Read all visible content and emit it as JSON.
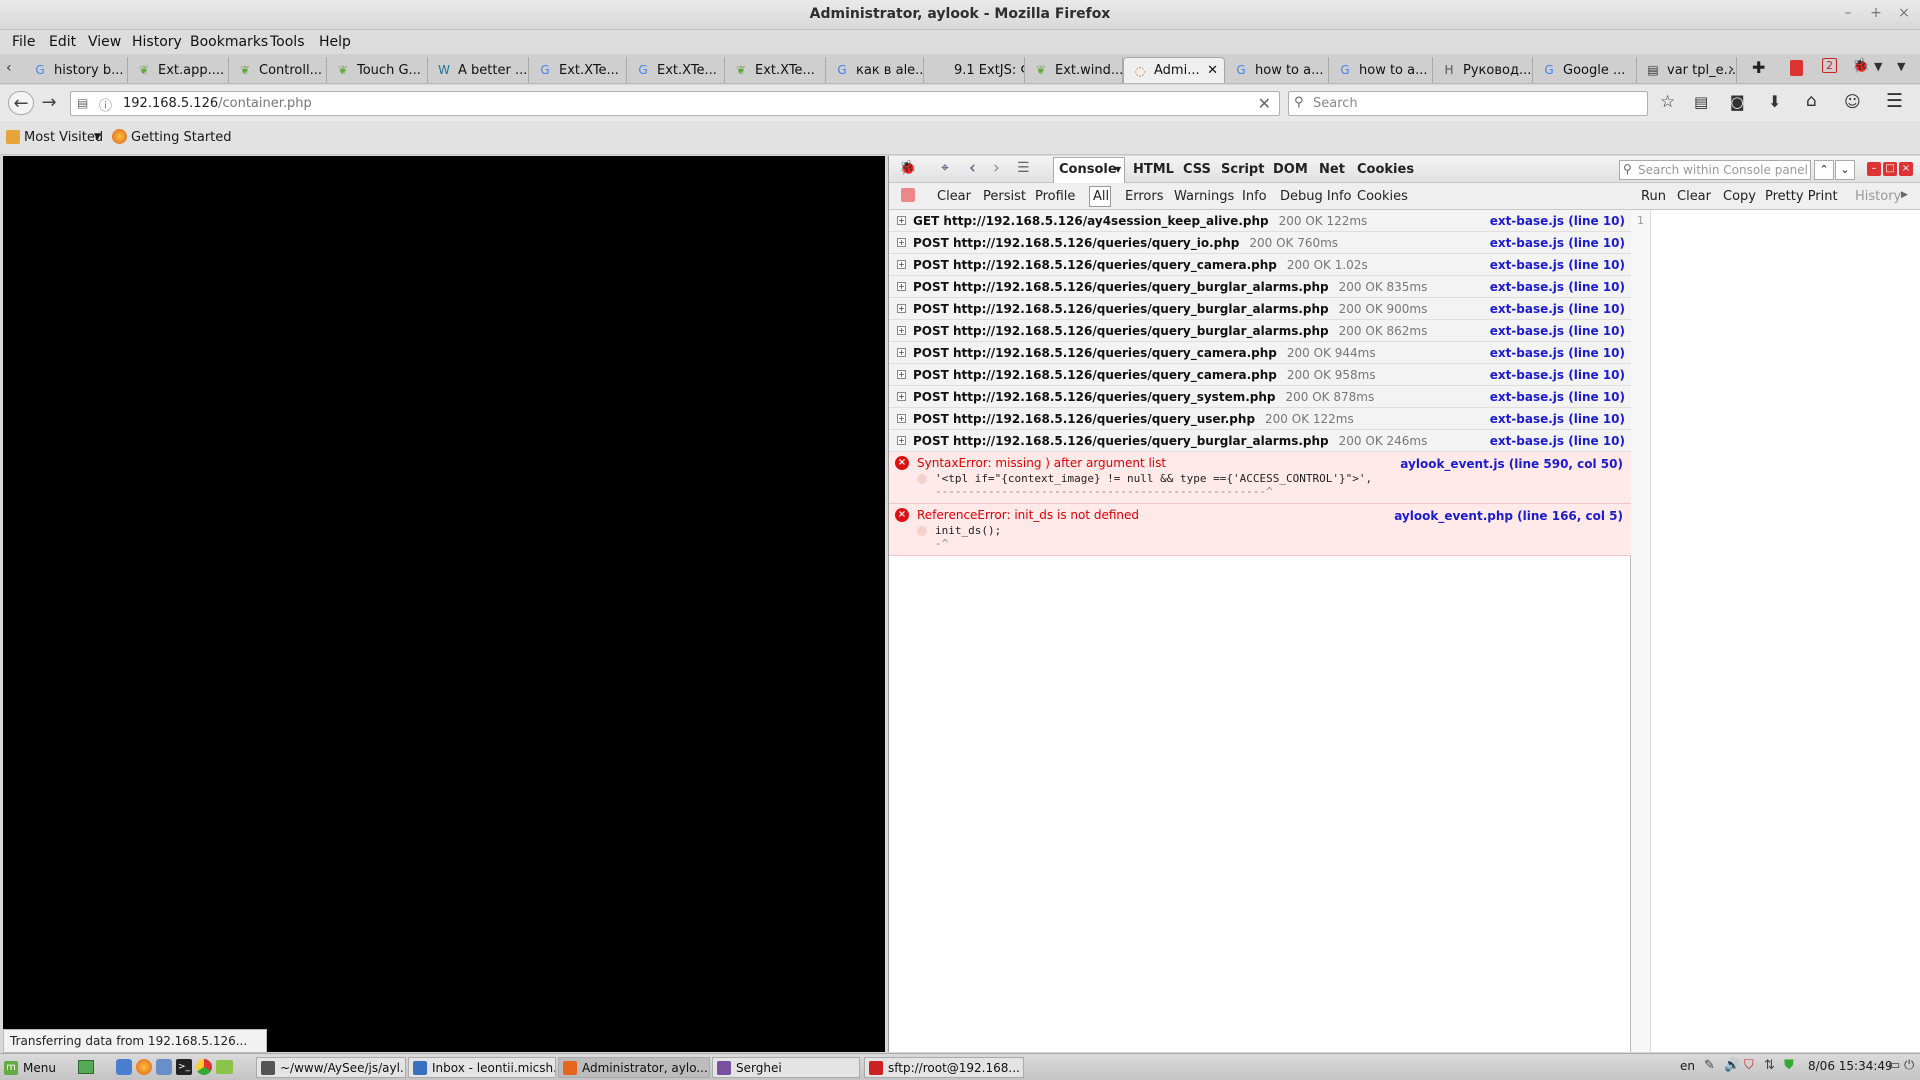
{
  "window": {
    "title": "Administrator, aylook - Mozilla Firefox"
  },
  "menu": [
    "File",
    "Edit",
    "View",
    "History",
    "Bookmarks",
    "Tools",
    "Help"
  ],
  "tabs": [
    {
      "label": "history b...",
      "icon": "google-icon"
    },
    {
      "label": "Ext.app....",
      "icon": "leaf-icon"
    },
    {
      "label": "Controll...",
      "icon": "leaf-icon"
    },
    {
      "label": "Touch G...",
      "icon": "leaf-icon"
    },
    {
      "label": "A better ...",
      "icon": "wordpress-icon"
    },
    {
      "label": "Ext.XTe...",
      "icon": "google-icon"
    },
    {
      "label": "Ext.XTe...",
      "icon": "google-icon"
    },
    {
      "label": "Ext.XTe...",
      "icon": "leaf-icon"
    },
    {
      "label": "как в ale...",
      "icon": "google-icon"
    },
    {
      "label": "9.1 ExtJS: Фо...",
      "icon": "none"
    },
    {
      "label": "Ext.wind...",
      "icon": "leaf-icon"
    },
    {
      "label": "Admi...",
      "icon": "loading-icon",
      "active": true
    },
    {
      "label": "how to a...",
      "icon": "google-icon"
    },
    {
      "label": "how to a...",
      "icon": "google-icon"
    },
    {
      "label": "Руковод...",
      "icon": "habr-icon"
    },
    {
      "label": "Google ...",
      "icon": "google-translate-icon"
    },
    {
      "label": "var tpl_e...",
      "icon": "script-icon"
    }
  ],
  "nav": {
    "url_host": "192.168.5.126",
    "url_path": "/container.php",
    "search_placeholder": "Search"
  },
  "bookmarks": {
    "most_visited": "Most Visited",
    "getting_started": "Getting Started"
  },
  "status": {
    "text": "Transferring data from 192.168.5.126..."
  },
  "firebug": {
    "panels": [
      "Console",
      "HTML",
      "CSS",
      "Script",
      "DOM",
      "Net",
      "Cookies"
    ],
    "search_placeholder": "Search within Console panel",
    "sub_left": [
      "Clear",
      "Persist",
      "Profile"
    ],
    "filters": [
      "All",
      "Errors",
      "Warnings",
      "Info",
      "Debug Info",
      "Cookies"
    ],
    "sub_right": [
      "Run",
      "Clear",
      "Copy",
      "Pretty Print",
      "History"
    ],
    "line_number": "1",
    "requests": [
      {
        "method": "GET",
        "url": "http://192.168.5.126/ay4session_keep_alive.php",
        "status": "200 OK 122ms",
        "source": "ext-base.js (line 10)"
      },
      {
        "method": "POST",
        "url": "http://192.168.5.126/queries/query_io.php",
        "status": "200 OK 760ms",
        "source": "ext-base.js (line 10)"
      },
      {
        "method": "POST",
        "url": "http://192.168.5.126/queries/query_camera.php",
        "status": "200 OK 1.02s",
        "source": "ext-base.js (line 10)"
      },
      {
        "method": "POST",
        "url": "http://192.168.5.126/queries/query_burglar_alarms.php",
        "status": "200 OK 835ms",
        "source": "ext-base.js (line 10)"
      },
      {
        "method": "POST",
        "url": "http://192.168.5.126/queries/query_burglar_alarms.php",
        "status": "200 OK 900ms",
        "source": "ext-base.js (line 10)"
      },
      {
        "method": "POST",
        "url": "http://192.168.5.126/queries/query_burglar_alarms.php",
        "status": "200 OK 862ms",
        "source": "ext-base.js (line 10)"
      },
      {
        "method": "POST",
        "url": "http://192.168.5.126/queries/query_camera.php",
        "status": "200 OK 944ms",
        "source": "ext-base.js (line 10)"
      },
      {
        "method": "POST",
        "url": "http://192.168.5.126/queries/query_camera.php",
        "status": "200 OK 958ms",
        "source": "ext-base.js (line 10)"
      },
      {
        "method": "POST",
        "url": "http://192.168.5.126/queries/query_system.php",
        "status": "200 OK 878ms",
        "source": "ext-base.js (line 10)"
      },
      {
        "method": "POST",
        "url": "http://192.168.5.126/queries/query_user.php",
        "status": "200 OK 122ms",
        "source": "ext-base.js (line 10)"
      },
      {
        "method": "POST",
        "url": "http://192.168.5.126/queries/query_burglar_alarms.php",
        "status": "200 OK 246ms",
        "source": "ext-base.js (line 10)"
      }
    ],
    "errors": [
      {
        "message": "SyntaxError: missing ) after argument list",
        "code": "'<tpl if=\"{context_image} != null && type =={'ACCESS_CONTROL'}\">',",
        "pointer": "--------------------------------------------------^",
        "source": "aylook_event.js (line 590, col 50)"
      },
      {
        "message": "ReferenceError: init_ds is not defined",
        "code": "init_ds();",
        "pointer": "-^",
        "source": "aylook_event.php (line 166, col 5)"
      }
    ]
  },
  "taskbar": {
    "menu_label": "Menu",
    "windows": [
      {
        "label": "~/www/AySee/js/ayl...",
        "icon": "editor-icon"
      },
      {
        "label": "Inbox - leontii.micsh...",
        "icon": "thunderbird-icon"
      },
      {
        "label": "Administrator, aylo...",
        "icon": "firefox-icon",
        "active": true
      },
      {
        "label": "Serghei",
        "icon": "pidgin-icon"
      },
      {
        "label": "sftp://root@192.168...",
        "icon": "filezilla-icon"
      }
    ],
    "lang": "en",
    "clock": "8/06 15:34:49"
  },
  "colors": {
    "link": "#1b1bd0",
    "error": "#d00000",
    "error_bg": "#ffe9e9"
  }
}
